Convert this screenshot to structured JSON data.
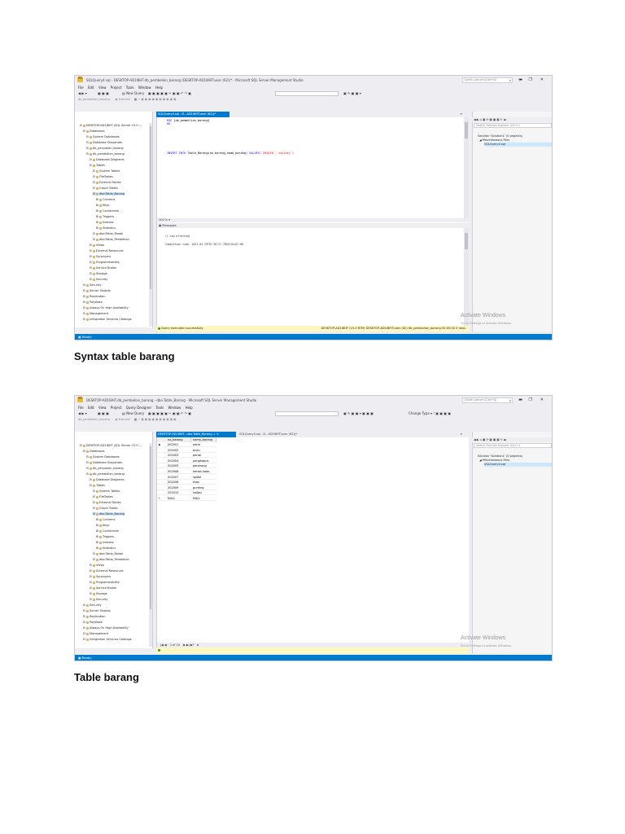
{
  "captions": {
    "first": "Syntax table barang",
    "second": "Table barang"
  },
  "shot1": {
    "title": "SQLQuery4.sql - DESKTOP-AD1I8HT.db_pembelian_barang (DESKTOP-AD1I8HT\\user (62))* - Microsoft SQL Server Management Studio",
    "quick_launch": "Quick Launch (Ctrl+Q)",
    "menu": [
      "File",
      "Edit",
      "View",
      "Project",
      "Tools",
      "Window",
      "Help"
    ],
    "new_query": "New Query",
    "execute": "Execute",
    "db_combo": "db_pembelian_barang",
    "object_explorer_title": "Object Explorer",
    "connect": "Connect",
    "tab_label": "SQLQuery4.sql - D...AD1I8HT\\user (62))*",
    "code_line1_kw": "USE",
    "code_line1_rest": "[db_pembelian_barang]",
    "code_line2": "GO",
    "code_insert_kw1": "INSERT INTO",
    "code_insert_mid": "Table_Barang(no_barang,nama_barang)",
    "code_insert_kw2": "VALUES",
    "code_insert_str": "('202010','isolasi')",
    "zoom1": "100 %",
    "messages_title": "Messages",
    "msg1": "(1 row affected)",
    "msg2": "Completion time: 2021-04-29T07:36:27.7852134+07:00",
    "zoom2": "100 %",
    "status_ok": "Query executed successfully.",
    "status_info": "DESKTOP-AD1I8HT (15.0 RTM)   DESKTOP-AD1I8HT\\user (62)   db_pembelian_barang   00:00:00   0 rows",
    "solution_title": "Solution Explorer",
    "se_search": "Search Solution Explorer (Ctrl+;)",
    "se_items": [
      "Solution 'Solution1' (0 projects)",
      "Miscellaneous Files",
      "SQLQuery4.sql"
    ],
    "watermark1": "Activate Windows",
    "watermark2": "Go to Settings to activate Windows.",
    "statusbar": "Ready",
    "tree": [
      "DESKTOP-AD1I8HT (SQL Server 15.0 ...",
      "Databases",
      "System Databases",
      "Database Snapshots",
      "db_penjualan_barang",
      "db_pembelian_barang",
      "Database Diagrams",
      "Tables",
      "System Tables",
      "FileTables",
      "External Tables",
      "Graph Tables",
      "dbo.Table_Barang",
      "Columns",
      "Keys",
      "Constraints",
      "Triggers",
      "Indexes",
      "Statistics",
      "dbo.Table_Modal",
      "dbo.Table_Pembelian",
      "Views",
      "External Resources",
      "Synonyms",
      "Programmability",
      "Service Broker",
      "Storage",
      "Security",
      "Security",
      "Server Objects",
      "Replication",
      "PolyBase",
      "Always On High Availability",
      "Management",
      "Integration Services Catalogs"
    ]
  },
  "shot2": {
    "title": "DESKTOP-AD1I8HT.db_pembelian_barang - dbo.Table_Barang - Microsoft SQL Server Management Studio",
    "quick_launch": "Quick Launch (Ctrl+Q)",
    "menu": [
      "File",
      "Edit",
      "View",
      "Project",
      "Query Designer",
      "Tools",
      "Window",
      "Help"
    ],
    "new_query": "New Query",
    "change_type": "Change Type",
    "execute": "Execute",
    "db_combo": "db_pembelian_barang",
    "object_explorer_title": "Object Explorer",
    "connect": "Connect",
    "tab_active": "DESKTOP-AD1I8HT...dbo.Table_Barang",
    "tab_inactive": "SQLQuery4.sql - D...AD1I8HT\\user (62))*",
    "columns": [
      "no_barang",
      "nama_barang"
    ],
    "rows": [
      [
        "202001",
        "pena"
      ],
      [
        "202002",
        "buku"
      ],
      [
        "202003",
        "pensil"
      ],
      [
        "202004",
        "penghapus"
      ],
      [
        "202005",
        "penerang"
      ],
      [
        "202006",
        "kertas kado"
      ],
      [
        "202007",
        "spidol"
      ],
      [
        "202008",
        "map"
      ],
      [
        "202009",
        "gunting"
      ],
      [
        "202010",
        "isolasi"
      ],
      [
        "NULL",
        "NULL"
      ]
    ],
    "pager": "1   of 10",
    "solution_title": "Solution Explorer",
    "se_search": "Search Solution Explorer (Ctrl+;)",
    "se_items": [
      "Solution 'Solution1' (0 projects)",
      "Miscellaneous Files",
      "SQLQuery4.sql"
    ],
    "watermark1": "Activate Windows",
    "watermark2": "Go to Settings to activate Windows.",
    "statusbar": "Ready",
    "tree": [
      "DESKTOP-AD1I8HT (SQL Server 15.0 ...",
      "Databases",
      "System Databases",
      "Database Snapshots",
      "db_penjualan_barang",
      "db_pembelian_barang",
      "Database Diagrams",
      "Tables",
      "System Tables",
      "FileTables",
      "External Tables",
      "Graph Tables",
      "dbo.Table_Barang",
      "Columns",
      "Keys",
      "Constraints",
      "Triggers",
      "Indexes",
      "Statistics",
      "dbo.Table_Modal",
      "dbo.Table_Pembelian",
      "Views",
      "External Resources",
      "Synonyms",
      "Programmability",
      "Service Broker",
      "Storage",
      "Security",
      "Security",
      "Server Objects",
      "Replication",
      "PolyBase",
      "Always On High Availability",
      "Management",
      "Integration Services Catalogs"
    ]
  }
}
